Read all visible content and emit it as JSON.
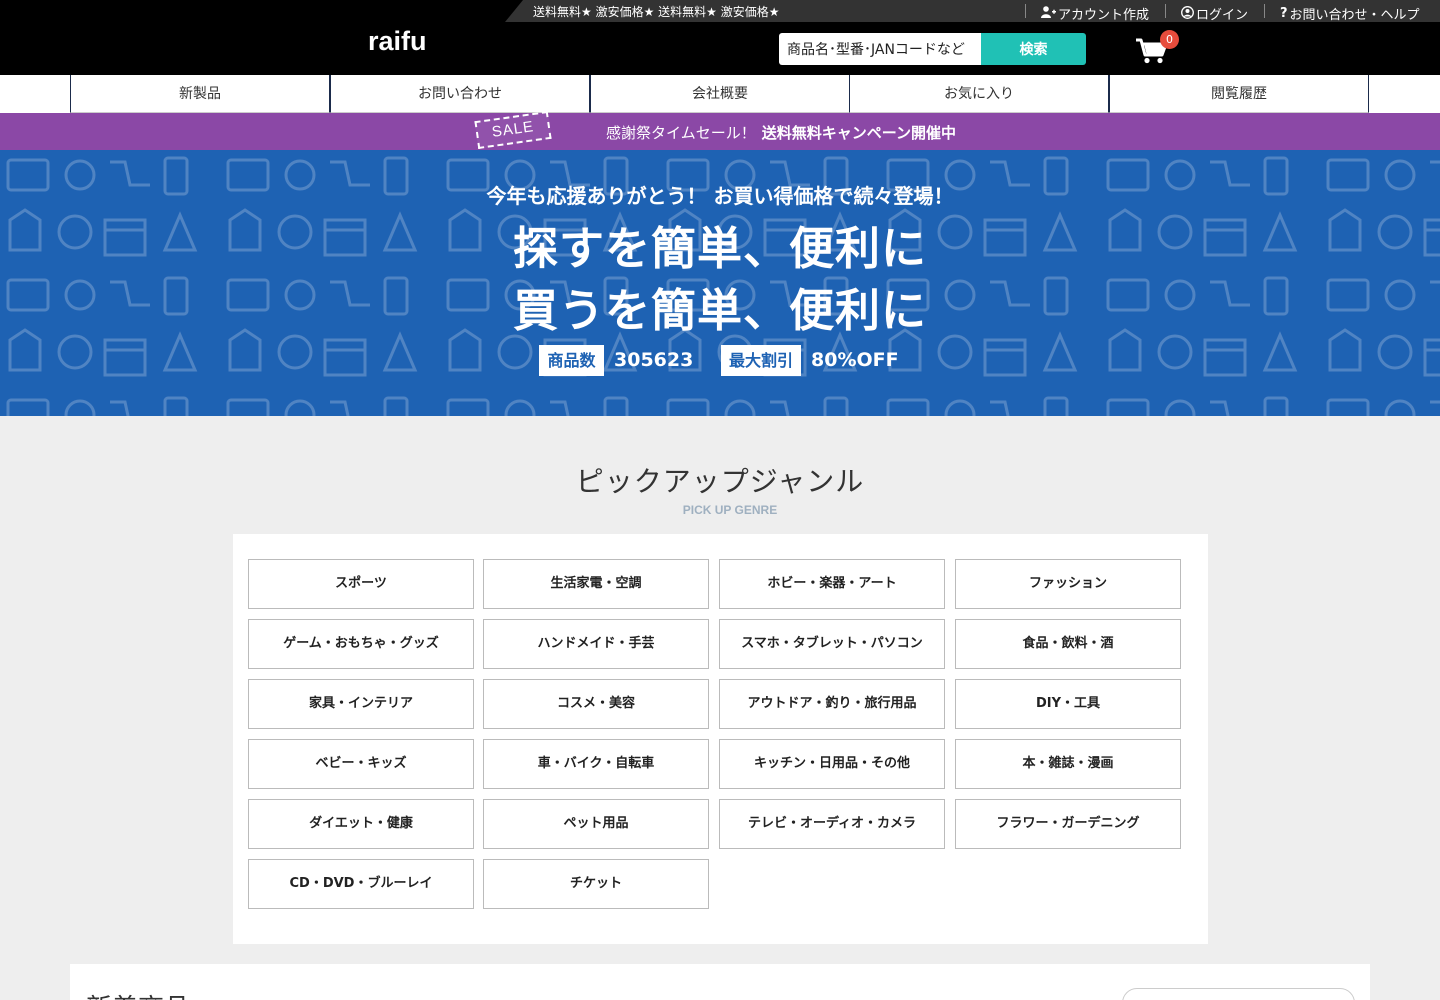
{
  "header": {
    "ticker": "送料無料★ 激安価格★ 送料無料★ 激安価格★",
    "account_link": "アカウント作成",
    "login_link": "ログイン",
    "help_link": "お問い合わせ・ヘルプ",
    "logo": "raifu",
    "search_value": "商品名･型番･JANコードなど",
    "search_button": "検索",
    "cart_count": "0"
  },
  "nav": {
    "items": [
      {
        "label": "新製品"
      },
      {
        "label": "お問い合わせ"
      },
      {
        "label": "会社概要"
      },
      {
        "label": "お気に入り"
      },
      {
        "label": "閲覧履歴"
      }
    ]
  },
  "salebar": {
    "stamp": "SALE",
    "text": "感謝祭タイムセール！",
    "strong": "送料無料キャンペーン開催中"
  },
  "hero": {
    "subtitle": "今年も応援ありがとう！ お買い得価格で続々登場！",
    "line1": "探すを簡単、便利に",
    "line2": "買うを簡単、便利に",
    "stat1_label": "商品数",
    "stat1_value": "305623",
    "stat2_label": "最大割引",
    "stat2_value": "80%OFF"
  },
  "pickup": {
    "title": "ピックアップジャンル",
    "subtitle": "PICK UP GENRE",
    "genres": [
      "スポーツ",
      "生活家電・空調",
      "ホビー・楽器・アート",
      "ファッション",
      "ゲーム・おもちゃ・グッズ",
      "ハンドメイド・手芸",
      "スマホ・タブレット・パソコン",
      "食品・飲料・酒",
      "家具・インテリア",
      "コスメ・美容",
      "アウトドア・釣り・旅行用品",
      "DIY・工具",
      "ベビー・キッズ",
      "車・バイク・自転車",
      "キッチン・日用品・その他",
      "本・雑誌・漫画",
      "ダイエット・健康",
      "ペット用品",
      "テレビ・オーディオ・カメラ",
      "フラワー・ガーデニング",
      "CD・DVD・ブルーレイ",
      "チケット"
    ]
  },
  "newproducts": {
    "title": "新着商品"
  },
  "colors": {
    "header_bg": "#000000",
    "accent_teal": "#20c1b5",
    "sale_purple": "#8b48a6",
    "hero_blue": "#1e62b3",
    "badge_red": "#e74c3c"
  },
  "icons": [
    "user-plus-icon",
    "user-circle-icon",
    "question-icon",
    "cart-icon"
  ]
}
